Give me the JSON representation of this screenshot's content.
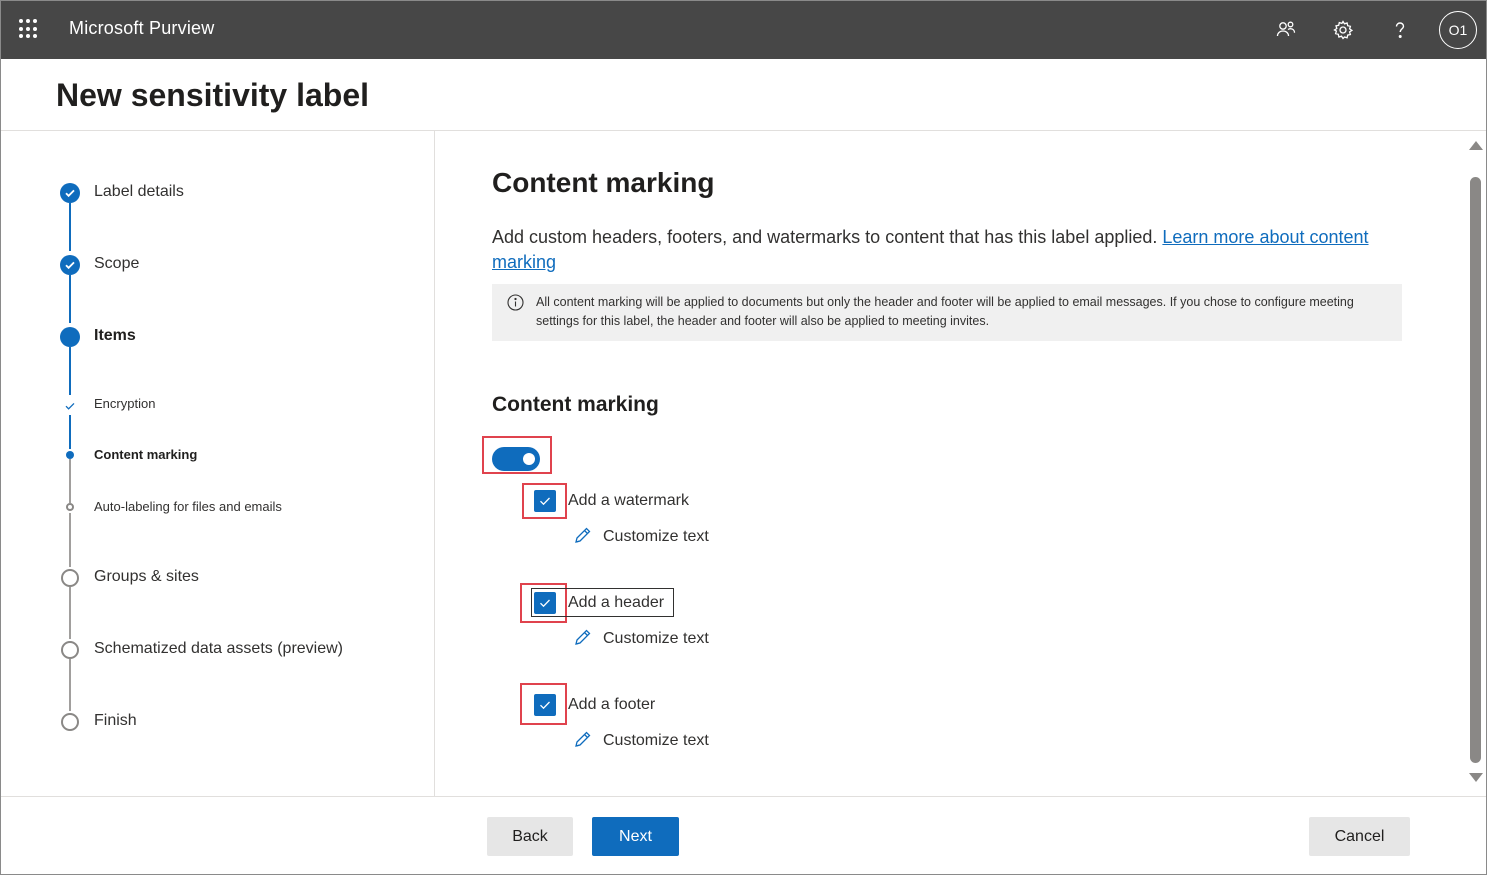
{
  "app": {
    "title": "Microsoft Purview",
    "avatar_initials": "O1",
    "icons": [
      "app-launcher-icon",
      "people-connect-icon",
      "gear-icon",
      "help-icon"
    ]
  },
  "page": {
    "title": "New sensitivity label"
  },
  "wizard": {
    "steps": [
      {
        "label": "Label details",
        "state": "completed"
      },
      {
        "label": "Scope",
        "state": "completed"
      },
      {
        "label": "Items",
        "state": "current"
      },
      {
        "label": "Groups & sites",
        "state": "not-started"
      },
      {
        "label": "Schematized data assets (preview)",
        "state": "not-started"
      },
      {
        "label": "Finish",
        "state": "not-started"
      }
    ],
    "substeps": [
      {
        "label": "Encryption",
        "state": "completed"
      },
      {
        "label": "Content marking",
        "state": "current"
      },
      {
        "label": "Auto-labeling for files and emails",
        "state": "not-started"
      }
    ]
  },
  "main": {
    "title": "Content marking",
    "description": "Add custom headers, footers, and watermarks to content that has this label applied. ",
    "learn_more_link": "Learn more about content marking",
    "info_text": "All content marking will be applied to documents but only the header and footer will be applied to email messages. If you chose to configure meeting settings for this label, the header and footer will also be applied to meeting invites.",
    "subsection_title": "Content marking",
    "toggle_on": true,
    "options": [
      {
        "label": "Add a watermark",
        "checked": true,
        "customize_label": "Customize text"
      },
      {
        "label": "Add a header",
        "checked": true,
        "customize_label": "Customize text"
      },
      {
        "label": "Add a footer",
        "checked": true,
        "customize_label": "Customize text"
      }
    ]
  },
  "footer": {
    "back_label": "Back",
    "next_label": "Next",
    "cancel_label": "Cancel"
  },
  "colors": {
    "accent": "#0f6cbd",
    "topbar": "#474747",
    "highlight": "#e0434d"
  }
}
